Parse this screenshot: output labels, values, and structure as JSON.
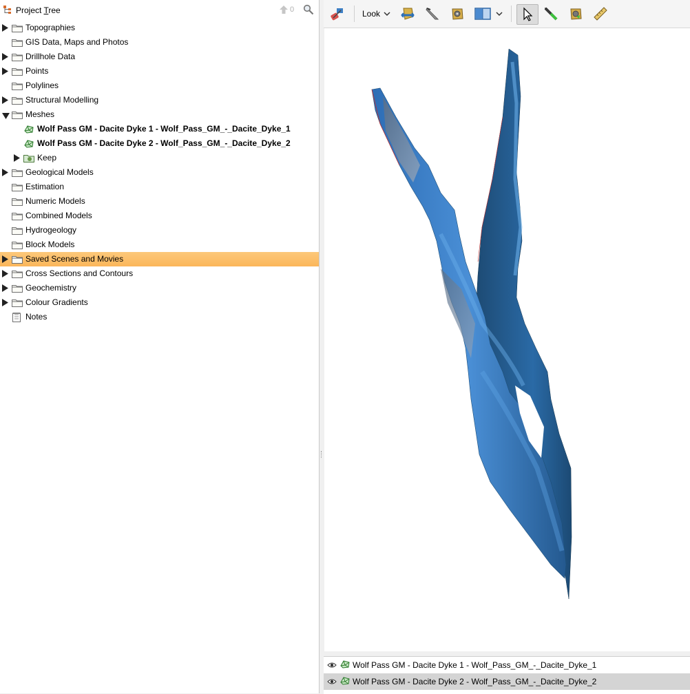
{
  "project_tree": {
    "title_prefix": "Project ",
    "title_underlined": "T",
    "title_suffix": "ree",
    "up_count": "0",
    "items": [
      {
        "label": "Topographies",
        "expandable": true,
        "expanded": false
      },
      {
        "label": "GIS Data, Maps and Photos",
        "expandable": false
      },
      {
        "label": "Drillhole Data",
        "expandable": true,
        "expanded": false
      },
      {
        "label": "Points",
        "expandable": true,
        "expanded": false
      },
      {
        "label": "Polylines",
        "expandable": false
      },
      {
        "label": "Structural Modelling",
        "expandable": true,
        "expanded": false
      },
      {
        "label": "Meshes",
        "expandable": true,
        "expanded": true
      },
      {
        "label": "Wolf Pass GM - Dacite Dyke 1 - Wolf_Pass_GM_-_Dacite_Dyke_1",
        "child": true,
        "icon": "mesh-icon"
      },
      {
        "label": "Wolf Pass GM - Dacite Dyke 2 - Wolf_Pass_GM_-_Dacite_Dyke_2",
        "child": true,
        "icon": "mesh-icon"
      },
      {
        "label": "Keep",
        "child": true,
        "icon": "keep-folder-icon",
        "expandable": true
      },
      {
        "label": "Geological Models",
        "expandable": true,
        "expanded": false
      },
      {
        "label": "Estimation",
        "expandable": false
      },
      {
        "label": "Numeric Models",
        "expandable": false
      },
      {
        "label": "Combined Models",
        "expandable": false
      },
      {
        "label": "Hydrogeology",
        "expandable": false
      },
      {
        "label": "Block Models",
        "expandable": false
      },
      {
        "label": "Saved Scenes and Movies",
        "expandable": true,
        "expanded": false,
        "selected": true
      },
      {
        "label": "Cross Sections and Contours",
        "expandable": true,
        "expanded": false
      },
      {
        "label": "Geochemistry",
        "expandable": true,
        "expanded": false
      },
      {
        "label": "Colour Gradients",
        "expandable": true,
        "expanded": false
      },
      {
        "label": "Notes",
        "expandable": false,
        "icon": "notes-icon"
      }
    ]
  },
  "toolbar": {
    "look_label": "Look",
    "tools": [
      "scene-tool-icon",
      "look-dropdown",
      "slice-tool-icon",
      "knife-icon",
      "gear-mesh-icon",
      "split-view-icon",
      "select-cursor-icon",
      "pen-icon",
      "gear-mesh-2-icon",
      "ruler-icon"
    ]
  },
  "scene_list": {
    "items": [
      {
        "label": "Wolf Pass GM - Dacite Dyke 1 - Wolf_Pass_GM_-_Dacite_Dyke_1",
        "selected": false
      },
      {
        "label": "Wolf Pass GM - Dacite Dyke 2 - Wolf_Pass_GM_-_Dacite_Dyke_2",
        "selected": true
      }
    ]
  },
  "colors": {
    "selection": "#fbb65a",
    "mesh_blue": "#3a7fc6",
    "mesh_dark": "#1e4f78"
  }
}
